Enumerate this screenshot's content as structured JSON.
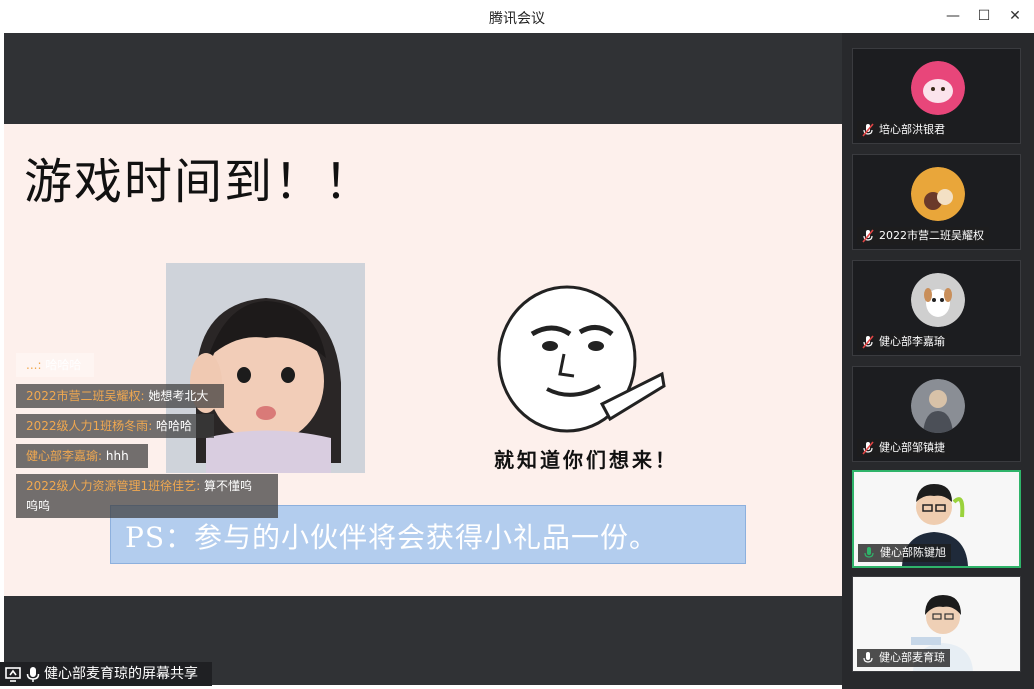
{
  "window": {
    "title": "腾讯会议",
    "controls": {
      "minimize": "—",
      "maximize": "☐",
      "close": "✕"
    }
  },
  "slide": {
    "title": "游戏时间到！！",
    "meme_caption": "就知道你们想来！",
    "ps_text": "PS：参与的小伙伴将会获得小礼品一份。"
  },
  "chat": [
    {
      "who": "...",
      "sep": ":",
      "text": " 哈哈哈"
    },
    {
      "who": "2022市营二班吴耀权",
      "sep": ":",
      "text": " 她想考北大"
    },
    {
      "who": "2022级人力1班杨冬雨",
      "sep": ":",
      "text": " 哈哈哈"
    },
    {
      "who": "健心部李嘉瑜",
      "sep": ":",
      "text": " hhh"
    },
    {
      "who": "2022级人力资源管理1班徐佳艺",
      "sep": ":",
      "text": " 算不懂呜",
      "text2": "呜呜"
    }
  ],
  "share_bar": {
    "label": "健心部麦育琼的屏幕共享"
  },
  "participants": [
    {
      "name": "培心部洪银君",
      "mic": "muted",
      "avatar_color": "#e8467a"
    },
    {
      "name": "2022市营二班吴耀权",
      "mic": "muted",
      "avatar_color": "#e9a63a"
    },
    {
      "name": "健心部李嘉瑜",
      "mic": "muted",
      "avatar_color": "#cfcfcf"
    },
    {
      "name": "健心部邹镇捷",
      "mic": "muted",
      "avatar_color": "#8a8e95"
    },
    {
      "name": "健心部陈键旭",
      "mic": "active",
      "avatar_color": "#f6f6f6"
    },
    {
      "name": "健心部麦育琼",
      "mic": "on",
      "avatar_color": "#f6f6f6"
    }
  ],
  "colors": {
    "accent_green": "#2fb46a",
    "chat_name": "#f0a850",
    "ps_bg": "#b3cdee"
  }
}
